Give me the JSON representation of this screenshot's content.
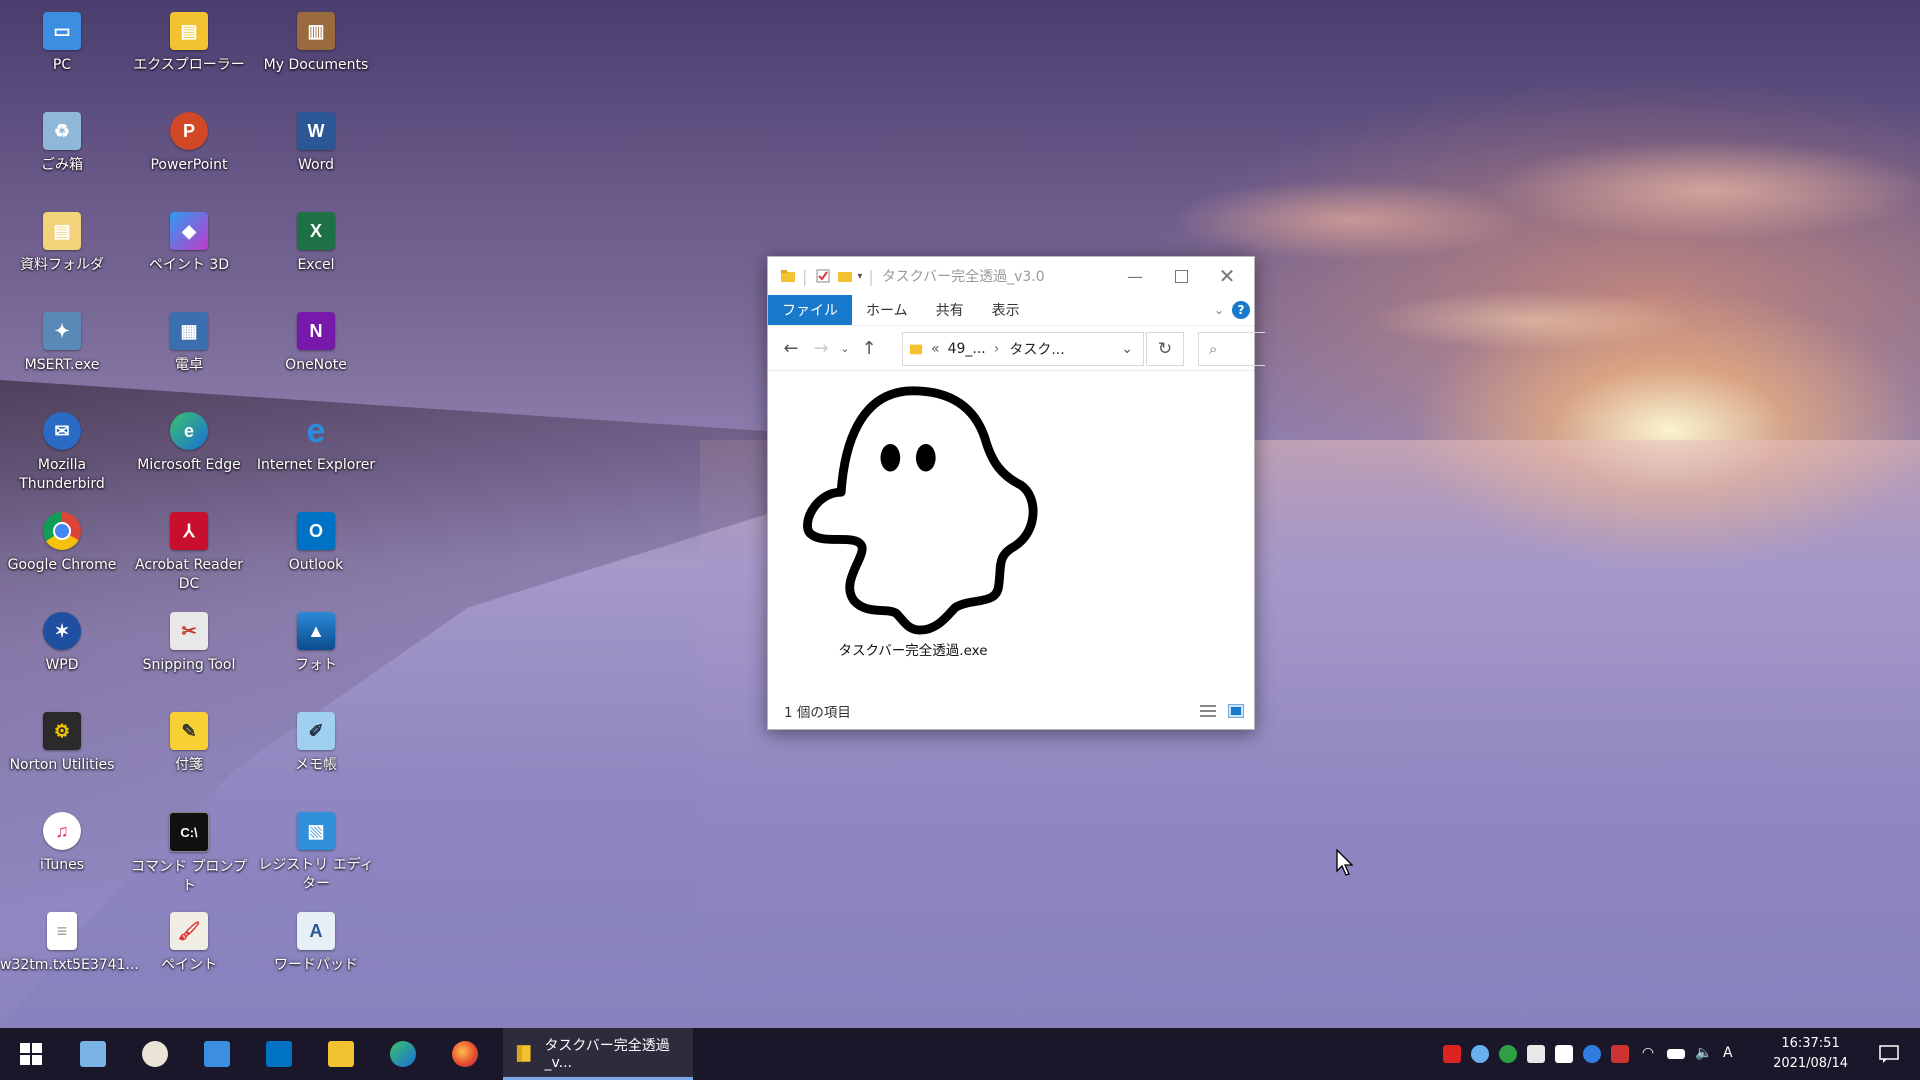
{
  "desktop": {
    "icons": [
      {
        "label": "PC",
        "icon": "pc-icon"
      },
      {
        "label": "エクスプローラー",
        "icon": "explorer-icon"
      },
      {
        "label": "My Documents",
        "icon": "my-documents-icon"
      },
      {
        "label": "ごみ箱",
        "icon": "recycle-bin-icon"
      },
      {
        "label": "PowerPoint",
        "icon": "powerpoint-icon"
      },
      {
        "label": "Word",
        "icon": "word-icon"
      },
      {
        "label": "資料フォルダ",
        "icon": "folder-icon"
      },
      {
        "label": "ペイント 3D",
        "icon": "paint-3d-icon"
      },
      {
        "label": "Excel",
        "icon": "excel-icon"
      },
      {
        "label": "MSERT.exe",
        "icon": "msert-icon"
      },
      {
        "label": "電卓",
        "icon": "calculator-icon"
      },
      {
        "label": "OneNote",
        "icon": "onenote-icon"
      },
      {
        "label": "Mozilla Thunderbird",
        "icon": "thunderbird-icon"
      },
      {
        "label": "Microsoft Edge",
        "icon": "edge-icon"
      },
      {
        "label": "Internet Explorer",
        "icon": "internet-explorer-icon"
      },
      {
        "label": "Google Chrome",
        "icon": "chrome-icon"
      },
      {
        "label": "Acrobat Reader DC",
        "icon": "acrobat-icon"
      },
      {
        "label": "Outlook",
        "icon": "outlook-icon"
      },
      {
        "label": "WPD",
        "icon": "wpd-icon"
      },
      {
        "label": "Snipping Tool",
        "icon": "snipping-tool-icon"
      },
      {
        "label": "フォト",
        "icon": "photos-icon"
      },
      {
        "label": "Norton Utilities",
        "icon": "norton-icon"
      },
      {
        "label": "付箋",
        "icon": "sticky-notes-icon"
      },
      {
        "label": "メモ帳",
        "icon": "notepad-icon"
      },
      {
        "label": "iTunes",
        "icon": "itunes-icon"
      },
      {
        "label": "コマンド プロンプト",
        "icon": "command-prompt-icon"
      },
      {
        "label": "レジストリ エディター",
        "icon": "registry-editor-icon"
      },
      {
        "label": "w32tm.txt5E3741...",
        "icon": "text-file-icon"
      },
      {
        "label": "ペイント",
        "icon": "paint-icon"
      },
      {
        "label": "ワードパッド",
        "icon": "wordpad-icon"
      }
    ]
  },
  "explorer": {
    "title": "タスクバー完全透過_v3.0",
    "ribbon_tabs": [
      "ファイル",
      "ホーム",
      "共有",
      "表示"
    ],
    "breadcrumb": [
      "«",
      "49_...",
      "›",
      "タスク..."
    ],
    "file_name": "タスクバー完全透過.exe",
    "status": "1 個の項目"
  },
  "taskbar": {
    "active_task_label": "タスクバー完全透過_v...",
    "time": "16:37:51",
    "date": "2021/08/14"
  },
  "colors": {
    "ribbon_file_tab": "#1979ca",
    "taskbar_bg": "#100e1c",
    "task_underline": "#7aa8e6"
  }
}
